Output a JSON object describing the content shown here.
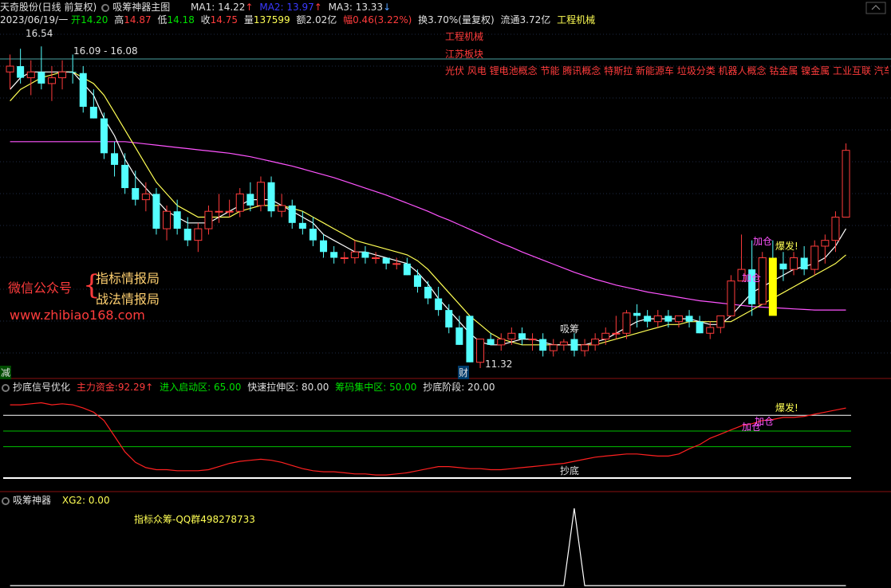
{
  "header": {
    "stock_name": "天奇股份(日线 前复权)",
    "indicator_name": "吸筹神器主图",
    "ma1": "MA1: 14.22",
    "ma2": "MA2: 13.97",
    "ma3": "MA3: 13.33",
    "date": "2023/06/19/一",
    "open_label": "开",
    "open": "14.20",
    "high_label": "高",
    "high": "14.87",
    "low_label": "低",
    "low": "14.18",
    "close_label": "收",
    "close": "14.75",
    "vol_label": "量",
    "vol": "137599",
    "amount_label": "额",
    "amount": "2.02亿",
    "chg_label": "幅",
    "chg": "0.46(3.22%)",
    "turnover_label": "换",
    "turnover": "3.70%(量复权)",
    "float_label": "流通",
    "float": "3.72亿",
    "industry": "工程机械"
  },
  "tags": {
    "industry": "工程机械",
    "region": "江苏板块",
    "concepts": "光伏 风电 锂电池概念 节能 腾讯概念 特斯拉 新能源车 垃圾分类 机器人概念 钴金属 镍金属 工业互联 汽车拆"
  },
  "promo": {
    "wechat": "微信公众号",
    "brace": "{",
    "item1": "指标情报局",
    "item2": "战法情报局",
    "url": "www.zhibiao168.com"
  },
  "sub1": {
    "name": "抄底信号优化",
    "zhuli_label": "主力资金:",
    "zhuli": "92.29",
    "jinru": "进入启动区: 65.00",
    "kuaisu": "快速拉伸区: 80.00",
    "choumaji": "筹码集中区: 50.00",
    "chaodi": "抄底阶段: 20.00"
  },
  "sub2": {
    "name": "吸筹神器",
    "xg2": "XG2: 0.00",
    "note": "指标众筹-QQ群498278733"
  },
  "annotations": {
    "price_high": "16.54",
    "range": "16.09 - 16.08",
    "price_low": "11.32",
    "xichou": "吸筹",
    "jiacang": "加仓",
    "baofa": "爆发!",
    "cai": "财",
    "jian": "减",
    "chaodi_mark": "抄底",
    "jiacang_sub": "加仓",
    "baofa_sub": "爆发!"
  },
  "colors": {
    "up": "#ff3c3c",
    "down": "#54ffff",
    "ma1": "#ffffff",
    "ma2": "#ffff54",
    "ma3": "#ff54ff",
    "signal": "#ff2020",
    "green_line": "#00ff00",
    "bg": "#000000"
  },
  "chart_data": {
    "type": "candlestick",
    "candles": [
      [
        16.1,
        16.4,
        15.8,
        16.2
      ],
      [
        16.2,
        16.5,
        15.9,
        16.0
      ],
      [
        16.0,
        16.3,
        15.7,
        16.1
      ],
      [
        16.1,
        16.54,
        15.8,
        15.9
      ],
      [
        15.9,
        16.2,
        15.6,
        16.0
      ],
      [
        16.0,
        16.3,
        15.8,
        16.1
      ],
      [
        16.1,
        16.4,
        15.9,
        16.09
      ],
      [
        16.08,
        16.2,
        15.4,
        15.5
      ],
      [
        15.5,
        15.8,
        15.3,
        15.3
      ],
      [
        15.3,
        15.4,
        14.6,
        14.7
      ],
      [
        14.7,
        14.9,
        14.3,
        14.5
      ],
      [
        14.5,
        14.7,
        14.0,
        14.1
      ],
      [
        14.1,
        14.4,
        13.8,
        13.9
      ],
      [
        13.9,
        14.2,
        13.7,
        14.0
      ],
      [
        14.0,
        14.1,
        13.3,
        13.4
      ],
      [
        13.4,
        13.8,
        13.2,
        13.7
      ],
      [
        13.7,
        13.9,
        13.3,
        13.4
      ],
      [
        13.4,
        13.6,
        13.1,
        13.2
      ],
      [
        13.2,
        13.5,
        13.0,
        13.4
      ],
      [
        13.4,
        13.8,
        13.3,
        13.7
      ],
      [
        13.7,
        14.0,
        13.5,
        13.7
      ],
      [
        13.7,
        13.9,
        13.6,
        13.7
      ],
      [
        13.7,
        14.1,
        13.6,
        14.0
      ],
      [
        14.0,
        14.2,
        13.7,
        13.8
      ],
      [
        13.8,
        14.3,
        13.7,
        14.2
      ],
      [
        14.2,
        14.3,
        13.6,
        13.7
      ],
      [
        13.7,
        14.0,
        13.6,
        13.8
      ],
      [
        13.8,
        13.9,
        13.4,
        13.5
      ],
      [
        13.5,
        13.7,
        13.3,
        13.4
      ],
      [
        13.4,
        13.6,
        13.1,
        13.2
      ],
      [
        13.2,
        13.3,
        12.9,
        13.0
      ],
      [
        13.0,
        13.1,
        12.8,
        12.9
      ],
      [
        12.9,
        13.0,
        12.8,
        12.9
      ],
      [
        12.9,
        13.2,
        12.8,
        13.0
      ],
      [
        13.0,
        13.1,
        12.8,
        12.9
      ],
      [
        12.9,
        13.0,
        12.8,
        12.9
      ],
      [
        12.9,
        12.9,
        12.7,
        12.8
      ],
      [
        12.8,
        12.9,
        12.7,
        12.8
      ],
      [
        12.8,
        12.9,
        12.6,
        12.6
      ],
      [
        12.6,
        12.7,
        12.3,
        12.4
      ],
      [
        12.4,
        12.5,
        12.1,
        12.2
      ],
      [
        12.2,
        12.4,
        11.9,
        12.0
      ],
      [
        12.0,
        12.1,
        11.6,
        11.7
      ],
      [
        11.7,
        11.9,
        11.4,
        11.4
      ],
      [
        11.9,
        11.9,
        11.1,
        11.1
      ],
      [
        11.1,
        11.5,
        11.0,
        11.5
      ],
      [
        11.5,
        11.6,
        11.4,
        11.4
      ],
      [
        11.4,
        11.6,
        11.3,
        11.5
      ],
      [
        11.5,
        11.7,
        11.4,
        11.6
      ],
      [
        11.6,
        11.7,
        11.4,
        11.5
      ],
      [
        11.5,
        11.6,
        11.3,
        11.5
      ],
      [
        11.5,
        11.6,
        11.2,
        11.3
      ],
      [
        11.3,
        11.5,
        11.2,
        11.4
      ],
      [
        11.4,
        11.5,
        11.3,
        11.45
      ],
      [
        11.5,
        11.6,
        11.2,
        11.3
      ],
      [
        11.3,
        11.5,
        11.2,
        11.4
      ],
      [
        11.4,
        11.6,
        11.3,
        11.5
      ],
      [
        11.5,
        11.7,
        11.4,
        11.6
      ],
      [
        11.6,
        11.9,
        11.5,
        11.6
      ],
      [
        11.6,
        12.0,
        11.5,
        11.95
      ],
      [
        11.95,
        12.1,
        11.7,
        11.9
      ],
      [
        11.9,
        12.0,
        11.7,
        11.8
      ],
      [
        11.8,
        12.0,
        11.7,
        11.9
      ],
      [
        11.9,
        12.0,
        11.7,
        11.8
      ],
      [
        11.8,
        11.9,
        11.7,
        11.9
      ],
      [
        11.9,
        12.0,
        11.7,
        11.8
      ],
      [
        11.8,
        11.9,
        11.6,
        11.6
      ],
      [
        11.6,
        11.8,
        11.5,
        11.7
      ],
      [
        11.7,
        11.9,
        11.6,
        11.9
      ],
      [
        11.9,
        12.6,
        11.9,
        12.5
      ],
      [
        12.5,
        13.3,
        12.5,
        12.7
      ],
      [
        12.7,
        13.2,
        11.9,
        12.1
      ],
      [
        12.1,
        13.0,
        12.1,
        12.9
      ],
      [
        12.9,
        13.2,
        12.6,
        12.8
      ],
      [
        12.8,
        13.0,
        12.5,
        12.7
      ],
      [
        12.7,
        13.0,
        12.6,
        12.9
      ],
      [
        12.9,
        13.1,
        12.6,
        12.7
      ],
      [
        12.7,
        13.2,
        12.6,
        13.1
      ],
      [
        13.1,
        13.3,
        12.8,
        13.2
      ],
      [
        13.2,
        13.7,
        13.0,
        13.6
      ],
      [
        13.6,
        14.87,
        13.6,
        14.75
      ]
    ],
    "ma1_values": [
      15.8,
      16.0,
      16.1,
      16.1,
      16.1,
      16.1,
      16.1,
      15.9,
      15.7,
      15.3,
      15.0,
      14.6,
      14.3,
      14.1,
      13.9,
      13.7,
      13.6,
      13.5,
      13.5,
      13.5,
      13.6,
      13.7,
      13.8,
      13.9,
      13.9,
      13.9,
      13.8,
      13.7,
      13.6,
      13.5,
      13.3,
      13.2,
      13.1,
      13.0,
      13.0,
      12.95,
      12.9,
      12.85,
      12.8,
      12.65,
      12.45,
      12.2,
      12.0,
      11.8,
      11.6,
      11.45,
      11.4,
      11.4,
      11.45,
      11.5,
      11.5,
      11.45,
      11.4,
      11.4,
      11.4,
      11.4,
      11.45,
      11.5,
      11.6,
      11.7,
      11.8,
      11.85,
      11.85,
      11.85,
      11.85,
      11.85,
      11.8,
      11.75,
      11.75,
      11.9,
      12.1,
      12.3,
      12.4,
      12.5,
      12.6,
      12.7,
      12.75,
      12.8,
      12.9,
      13.1,
      13.4
    ],
    "ma2_values": [
      15.6,
      15.8,
      15.9,
      16.0,
      16.05,
      16.1,
      16.1,
      16.0,
      15.9,
      15.7,
      15.4,
      15.1,
      14.8,
      14.5,
      14.2,
      14.0,
      13.8,
      13.7,
      13.6,
      13.6,
      13.6,
      13.6,
      13.7,
      13.75,
      13.8,
      13.8,
      13.8,
      13.75,
      13.7,
      13.6,
      13.5,
      13.4,
      13.3,
      13.2,
      13.15,
      13.1,
      13.05,
      13.0,
      12.95,
      12.85,
      12.7,
      12.5,
      12.3,
      12.1,
      11.9,
      11.75,
      11.6,
      11.5,
      11.45,
      11.4,
      11.4,
      11.4,
      11.4,
      11.4,
      11.4,
      11.4,
      11.4,
      11.45,
      11.5,
      11.55,
      11.6,
      11.65,
      11.7,
      11.75,
      11.75,
      11.8,
      11.8,
      11.8,
      11.8,
      11.8,
      11.9,
      12.0,
      12.1,
      12.2,
      12.3,
      12.4,
      12.5,
      12.6,
      12.7,
      12.8,
      12.95
    ],
    "ma3_values": [
      14.9,
      14.9,
      14.9,
      14.9,
      14.9,
      14.9,
      14.9,
      14.9,
      14.9,
      14.9,
      14.9,
      14.9,
      14.88,
      14.86,
      14.84,
      14.82,
      14.8,
      14.78,
      14.76,
      14.74,
      14.72,
      14.7,
      14.67,
      14.64,
      14.6,
      14.56,
      14.52,
      14.48,
      14.43,
      14.38,
      14.33,
      14.28,
      14.22,
      14.16,
      14.1,
      14.04,
      13.98,
      13.91,
      13.84,
      13.77,
      13.7,
      13.62,
      13.55,
      13.47,
      13.39,
      13.31,
      13.23,
      13.15,
      13.08,
      13.0,
      12.93,
      12.86,
      12.79,
      12.72,
      12.65,
      12.59,
      12.53,
      12.48,
      12.43,
      12.39,
      12.35,
      12.31,
      12.28,
      12.25,
      12.22,
      12.19,
      12.16,
      12.14,
      12.12,
      12.1,
      12.08,
      12.06,
      12.05,
      12.04,
      12.03,
      12.02,
      12.01,
      12.0,
      12.0,
      12.0,
      12.0
    ],
    "ylim": [
      11.0,
      16.9
    ],
    "signal_values": [
      90,
      90,
      91,
      92,
      90,
      91,
      90,
      87,
      83,
      75,
      60,
      45,
      35,
      30,
      28,
      28,
      27,
      27,
      27,
      28,
      31,
      34,
      36,
      37,
      38,
      37,
      35,
      32,
      29,
      27,
      26,
      26,
      25,
      24,
      24,
      23,
      23,
      24,
      25,
      27,
      29,
      31,
      31,
      30,
      29,
      29,
      28,
      28,
      29,
      30,
      31,
      32,
      33,
      34,
      36,
      38,
      40,
      41,
      42,
      43,
      43,
      42,
      41,
      41,
      43,
      48,
      52,
      58,
      62,
      66,
      70,
      72,
      75,
      76,
      78,
      78,
      79,
      81,
      83,
      85,
      87
    ],
    "signal_ylim": [
      20,
      100
    ],
    "levels": [
      92.29,
      65,
      80,
      50,
      20
    ],
    "xg2_values": [
      0,
      0,
      0,
      0,
      0,
      0,
      0,
      0,
      0,
      0,
      0,
      0,
      0,
      0,
      0,
      0,
      0,
      0,
      0,
      0,
      0,
      0,
      0,
      0,
      0,
      0,
      0,
      0,
      0,
      0,
      0,
      0,
      0,
      0,
      0,
      0,
      0,
      0,
      0,
      0,
      0,
      0,
      0,
      0,
      0,
      0,
      0,
      0,
      0,
      0,
      0,
      0,
      0,
      0,
      1,
      0,
      0,
      0,
      0,
      0,
      0,
      0,
      0,
      0,
      0,
      0,
      0,
      0,
      0,
      0,
      0,
      0,
      0,
      0,
      0,
      0,
      0,
      0,
      0,
      0,
      0
    ]
  }
}
